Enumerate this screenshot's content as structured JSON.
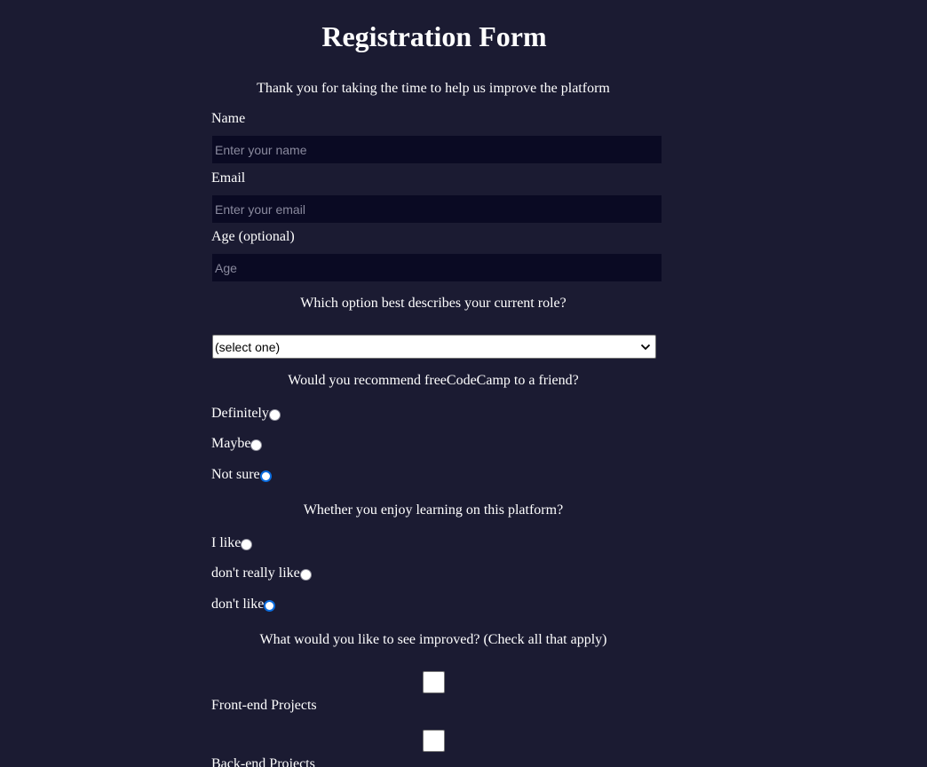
{
  "form": {
    "title": "Registration Form",
    "description": "Thank you for taking the time to help us improve the platform",
    "name": {
      "label": "Name",
      "placeholder": "Enter your name",
      "value": ""
    },
    "email": {
      "label": "Email",
      "placeholder": "Enter your email",
      "value": ""
    },
    "age": {
      "label": "Age (optional)",
      "placeholder": "Age",
      "value": ""
    },
    "role": {
      "question": "Which option best describes your current role?",
      "selected": "(select one)"
    },
    "recommend": {
      "question": "Would you recommend freeCodeCamp to a friend?",
      "options": [
        "Definitely",
        "Maybe",
        "Not sure"
      ],
      "checked": "Not sure"
    },
    "enjoy": {
      "question": "Whether you enjoy learning on this platform?",
      "options": [
        "I like",
        "don't really like",
        "don't like"
      ],
      "checked": "don't like"
    },
    "improve": {
      "question": "What would you like to see improved? (Check all that apply)",
      "options": [
        "Front-end Projects",
        "Back-end Projects"
      ]
    }
  },
  "colors": {
    "background": "#1b1b32",
    "input_background": "#0a0a23",
    "text": "#ffffff",
    "radio_checked": "#0b6cde"
  }
}
